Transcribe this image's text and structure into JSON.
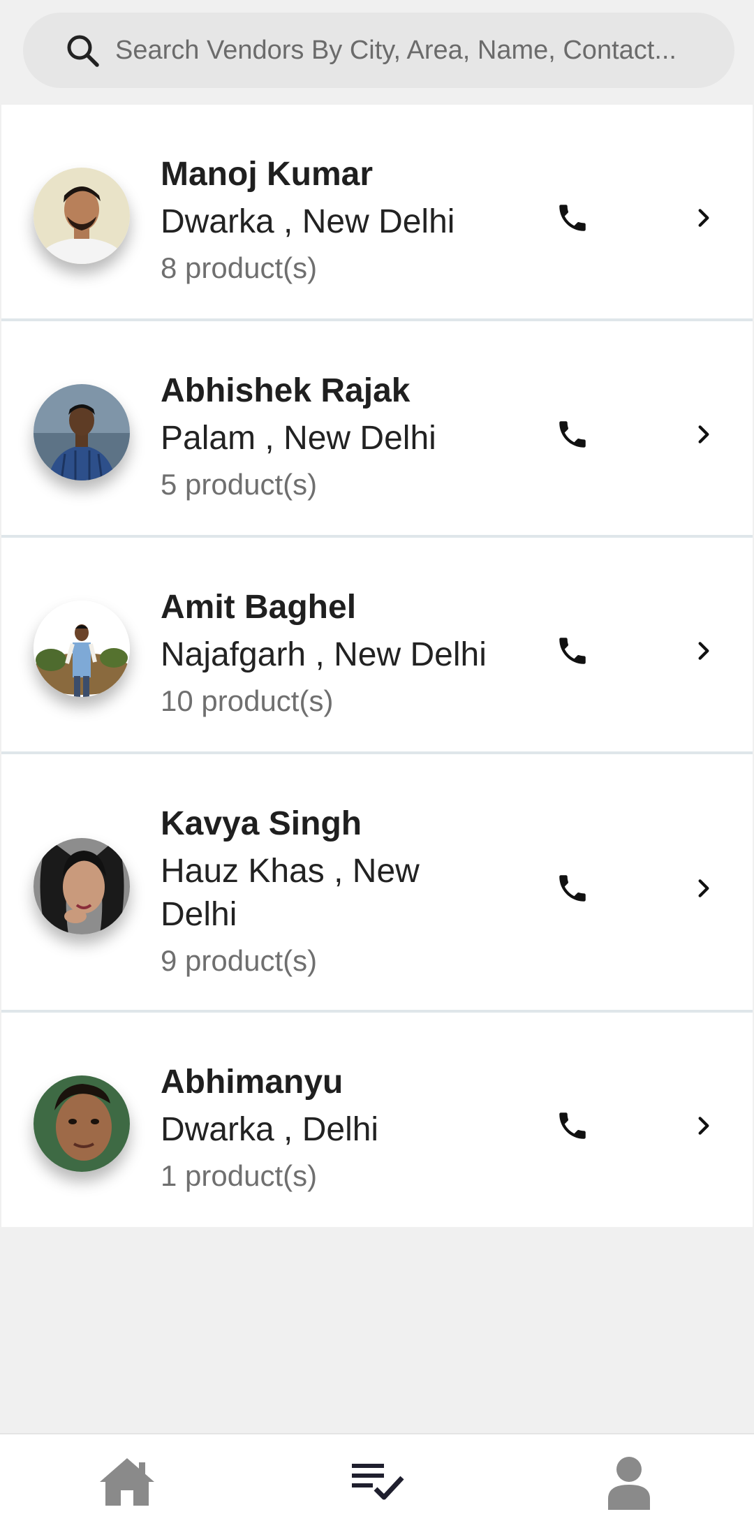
{
  "search": {
    "placeholder": "Search Vendors By City, Area, Name, Contact..."
  },
  "vendors": [
    {
      "name": "Manoj Kumar",
      "location": "Dwarka  , New Delhi",
      "products": "8 product(s)"
    },
    {
      "name": "Abhishek Rajak",
      "location": "Palam , New Delhi",
      "products": "5 product(s)"
    },
    {
      "name": "Amit Baghel",
      "location": "Najafgarh  , New Delhi",
      "products": "10 product(s)"
    },
    {
      "name": "Kavya Singh",
      "location": "Hauz Khas , New Delhi",
      "products": "9 product(s)"
    },
    {
      "name": "Abhimanyu",
      "location": "Dwarka  , Delhi",
      "products": "1 product(s)"
    }
  ],
  "bottom_nav": {
    "items": [
      "home-icon",
      "playlist-check-icon",
      "person-icon"
    ],
    "active_color": "#1f1f2e",
    "inactive_color": "#8a8a8a"
  }
}
